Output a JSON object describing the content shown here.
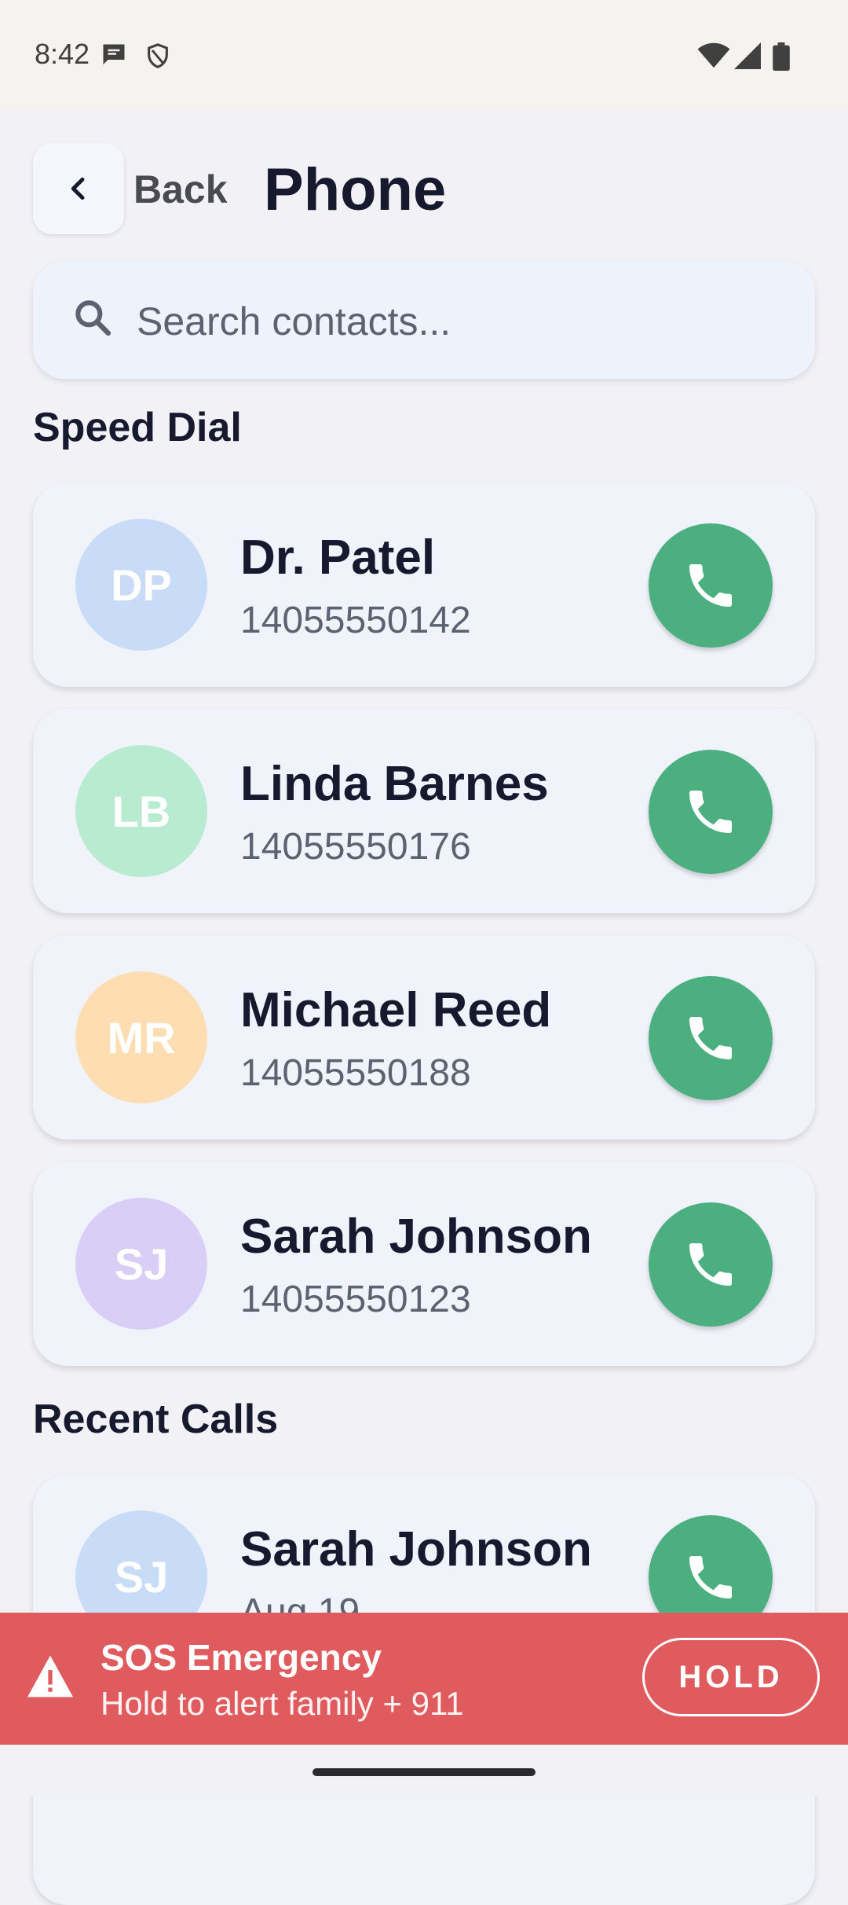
{
  "status_bar": {
    "time": "8:42",
    "icons": [
      "message-icon",
      "shield-icon",
      "wifi-icon",
      "signal-icon",
      "battery-icon"
    ]
  },
  "header": {
    "back_label": "Back",
    "title": "Phone"
  },
  "search": {
    "placeholder": "Search contacts..."
  },
  "speed_dial": {
    "title": "Speed Dial",
    "contacts": [
      {
        "initials": "DP",
        "name": "Dr. Patel",
        "number": "14055550142",
        "avatar_color": "#C8DCF7"
      },
      {
        "initials": "LB",
        "name": "Linda Barnes",
        "number": "14055550176",
        "avatar_color": "#B8EBCF"
      },
      {
        "initials": "MR",
        "name": "Michael Reed",
        "number": "14055550188",
        "avatar_color": "#FFDDB3"
      },
      {
        "initials": "SJ",
        "name": "Sarah Johnson",
        "number": "14055550123",
        "avatar_color": "#D9CFF6"
      }
    ]
  },
  "recent_calls": {
    "title": "Recent Calls",
    "items": [
      {
        "initials": "SJ",
        "name": "Sarah Johnson",
        "date": "Aug 19",
        "avatar_color": "#C8DCF7"
      }
    ]
  },
  "sos": {
    "title": "SOS Emergency",
    "subtitle": "Hold to alert family + 911",
    "button": "HOLD",
    "color": "#E05B5E"
  },
  "colors": {
    "call_button": "#4CAF80",
    "title_text": "#171A2E",
    "background": "#F2F1F6"
  }
}
